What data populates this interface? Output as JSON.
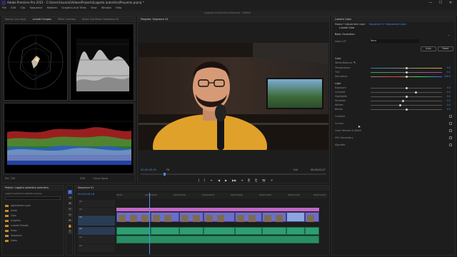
{
  "titlebar": {
    "title": "Adobe Premiere Pro 2021 - C:\\Users\\Usuario\\Videos\\Projects\\Lagarto autentico\\Proyecto.prproj *",
    "minimize": "—",
    "maximize": "☐",
    "close": "✕"
  },
  "menu": [
    "File",
    "Edit",
    "Clip",
    "Sequence",
    "Markers",
    "Graphics and Titles",
    "View",
    "Window",
    "Help"
  ],
  "workspace": {
    "label": "Lagarto autentico autentico",
    "suffix": "Edited"
  },
  "left_panel": {
    "tabs": [
      "Source: (no clips)",
      "Lumetri Scopes",
      "Effect Controls",
      "Audio Clip Mixer: Sequence 01"
    ],
    "active_tab": 1,
    "footer_left": "Rec. 709",
    "footer_mid": "8 Bit",
    "footer_right": "Clamp Signal"
  },
  "program": {
    "tab": "Program: Sequence 01",
    "timecode_current": "00;00;00;16",
    "fit": "Fit",
    "quality": "Full",
    "timecode_total": "00;00;02;27",
    "controls": [
      "{",
      "}",
      "⇤",
      "◀",
      "▶",
      "▶▶",
      "⇥",
      "⎘",
      "⎗",
      "📷",
      "+"
    ]
  },
  "lumetri": {
    "tab_title": "Lumetri Color",
    "subtabs": [
      "Master * Adjustment Layer",
      "Sequence 01 * Adjustment Layer"
    ],
    "fx_label": "Lumetri Color",
    "basic_correction": "Basic Correction",
    "input_lut_label": "Input LUT",
    "input_lut_value": "None",
    "auto_button": "Auto",
    "reset_button": "Reset",
    "color_header": "Color",
    "white_balance": "White Balance",
    "sliders_color": [
      {
        "label": "Temperature",
        "value": "0.0"
      },
      {
        "label": "Tint",
        "value": "0.0"
      },
      {
        "label": "Saturation",
        "value": "100.0"
      }
    ],
    "light_header": "Light",
    "sliders_light": [
      {
        "label": "Exposure",
        "value": "0.0"
      },
      {
        "label": "Contrast",
        "value": "0.0"
      },
      {
        "label": "Highlights",
        "value": "0.0"
      },
      {
        "label": "Shadows",
        "value": "0.0"
      },
      {
        "label": "Whites",
        "value": "0.0"
      },
      {
        "label": "Blacks",
        "value": "0.0"
      }
    ],
    "sections": [
      "Creative",
      "Curves",
      "Color Wheels & Match",
      "HSL Secondary",
      "Vignette"
    ]
  },
  "project": {
    "tab": "Project: Lagarto autentico autentico",
    "path": "Lagarto autentico autentico.prproj",
    "items": [
      "Adjustment Layer",
      "Audio",
      "Clips",
      "Graphics",
      "Lumetri Presets",
      "Music",
      "Sequence",
      "Video"
    ]
  },
  "timeline": {
    "tab": "Sequence 01",
    "timecode": "00;00;00;16",
    "ruler": [
      "00;00",
      "00;00;02;00",
      "00;00;04;00",
      "00;00;06;00",
      "00;00;08;00",
      "00;00;10;00",
      "00;00;12;00",
      "00;00;14;00"
    ],
    "tracks": [
      "V3",
      "V2",
      "V1",
      "A1",
      "A2",
      "A3"
    ],
    "clip_label": "Sequence 01"
  },
  "colors": {
    "accent": "#2f7de1",
    "video_clip": "#6d6fc4",
    "audio_clip": "#2e9f72",
    "playhead": "#4b8fe5",
    "panel_bg": "#1d1d1d"
  }
}
